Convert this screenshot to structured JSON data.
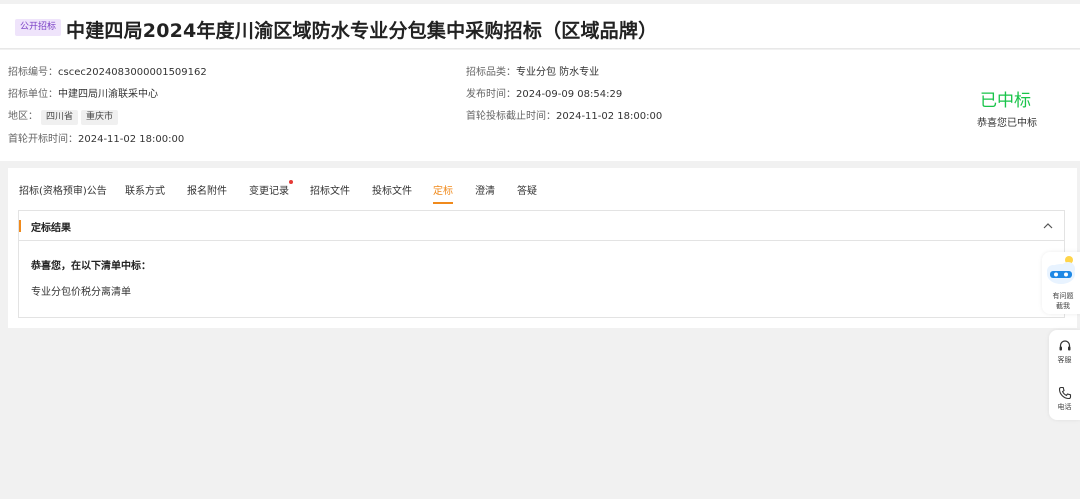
{
  "header": {
    "badge": "公开招标",
    "title": "中建四局2024年度川渝区域防水专业分包集中采购招标（区域品牌）"
  },
  "info": {
    "bid_no_label": "招标编号：",
    "bid_no": "cscec2024083000001509162",
    "unit_label": "招标单位：",
    "unit": "中建四局川渝联采中心",
    "region_label": "地区：",
    "regions": [
      "四川省",
      "重庆市"
    ],
    "open_time_label": "首轮开标时间：",
    "open_time": "2024-11-02 18:00:00",
    "category_label": "招标品类：",
    "category": "专业分包 防水专业",
    "publish_label": "发布时间：",
    "publish_time": "2024-09-09 08:54:29",
    "deadline_label": "首轮投标截止时间：",
    "deadline": "2024-11-02 18:00:00",
    "status": "已中标",
    "status_sub": "恭喜您已中标"
  },
  "tabs": [
    {
      "label": "招标(资格预审)公告"
    },
    {
      "label": "联系方式"
    },
    {
      "label": "报名附件"
    },
    {
      "label": "变更记录"
    },
    {
      "label": "招标文件"
    },
    {
      "label": "投标文件"
    },
    {
      "label": "定标"
    },
    {
      "label": "澄清"
    },
    {
      "label": "答疑"
    }
  ],
  "result": {
    "title": "定标结果",
    "congrats": "恭喜您，在以下清单中标：",
    "item": "专业分包价税分离清单"
  },
  "float": {
    "feedback_line1": "有问题",
    "feedback_line2": "截我",
    "service": "客服",
    "phone": "电话"
  },
  "colors": {
    "accent": "#f08a1c",
    "success": "#19c44a",
    "badge_bg": "#efe4fb",
    "badge_text": "#7a3fc5"
  }
}
